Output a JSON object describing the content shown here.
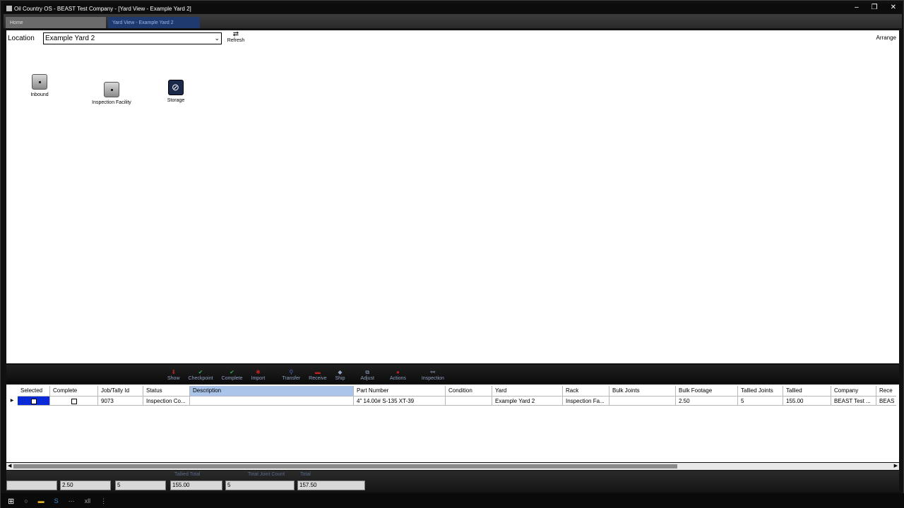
{
  "window": {
    "title": "Oil Country OS - BEAST Test Company - [Yard View - Example Yard 2]",
    "controls": [
      "–",
      "❐",
      "✕"
    ]
  },
  "tabs": [
    {
      "label": "Home"
    },
    {
      "label": "Yard View - Example Yard 2"
    }
  ],
  "location": {
    "label": "Location",
    "selected": "Example Yard 2",
    "refresh_label": "Refresh",
    "arrange_label": "Arrange"
  },
  "nodes": [
    {
      "label": "Inbound"
    },
    {
      "label": "Inspection Facility"
    },
    {
      "label": "Storage"
    }
  ],
  "toolbar": [
    {
      "label": "Show",
      "icon": "red-arrow-icon"
    },
    {
      "label": "Checkpoint",
      "icon": "green-check-icon"
    },
    {
      "label": "Complete",
      "icon": "green-check-icon"
    },
    {
      "label": "Import",
      "icon": "red-import-icon"
    },
    {
      "label": "Transfer",
      "icon": "search-icon"
    },
    {
      "label": "Receive",
      "icon": "receive-icon"
    },
    {
      "label": "Ship",
      "icon": "ship-icon"
    },
    {
      "label": "Adjust",
      "icon": "adjust-icon"
    },
    {
      "label": "Actions",
      "icon": "actions-icon"
    },
    {
      "label": "Inspection",
      "icon": "inspection-icon"
    }
  ],
  "grid": {
    "columns": [
      "Selected",
      "Complete",
      "Job/Tally Id",
      "Status",
      "Description",
      "Part Number",
      "Condition",
      "Yard",
      "Rack",
      "Bulk Joints",
      "Bulk Footage",
      "Tallied Joints",
      "Tallied",
      "Company",
      "Rece"
    ],
    "row": {
      "job_id": "9073",
      "status": "Inspection Co...",
      "description": "",
      "part_number": "4\" 14.00# S-135 XT-39",
      "condition": "",
      "yard": "Example Yard 2",
      "rack": "Inspection Fa...",
      "bulk_joints": "",
      "bulk_footage": "2.50",
      "tallied_joints": "5",
      "tallied": "155.00",
      "company": "BEAST Test ...",
      "rece": "BEAS"
    }
  },
  "totals": {
    "labels": {
      "tallied_total": "Tallied Total",
      "total_joint_count": "Total Joint Count",
      "total": "Total"
    },
    "values": {
      "bulk_footage": "2.50",
      "joints": "5",
      "tallied_total": "155.00",
      "total_joint_count": "5",
      "total": "157.50"
    }
  },
  "taskbar": {
    "label": "xll"
  }
}
